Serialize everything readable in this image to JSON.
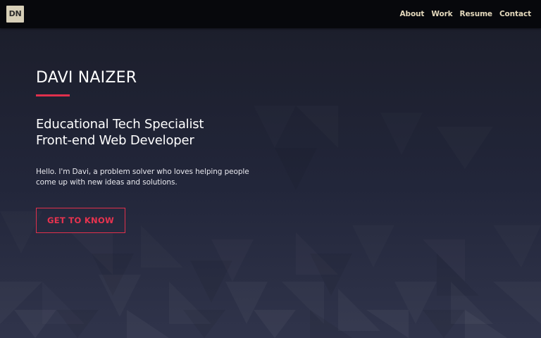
{
  "navbar": {
    "logo_text": "DN",
    "links": [
      {
        "label": "About"
      },
      {
        "label": "Work"
      },
      {
        "label": "Resume"
      },
      {
        "label": "Contact"
      }
    ]
  },
  "hero": {
    "name": "DAVI NAIZER",
    "roles": [
      "Educational Tech Specialist",
      "Front-end Web Developer"
    ],
    "intro_lines": [
      "Hello. I'm Davi, a problem solver who loves helping people",
      "come up with new ideas and solutions."
    ],
    "cta_label": "GET TO KNOW"
  },
  "colors": {
    "accent": "#e0304c",
    "nav_link": "#e4d9bd",
    "navbar_bg": "#07080c",
    "logo_bg": "#d7cfb8",
    "page_bg": "#1f2232"
  }
}
